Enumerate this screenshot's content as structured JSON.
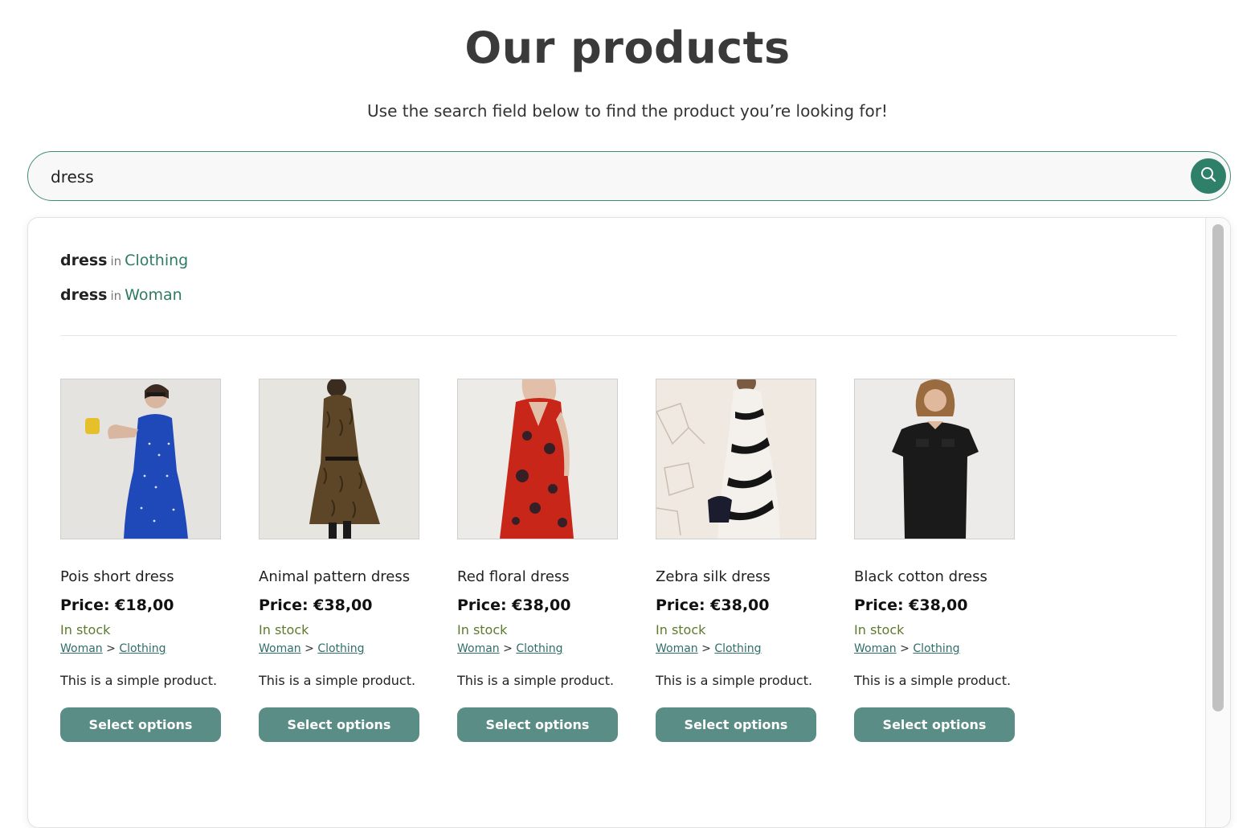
{
  "page": {
    "title": "Our products",
    "subtitle": "Use the search field below to find the product you’re looking for!"
  },
  "search": {
    "value": "dress",
    "icon": "search-icon",
    "accent_color": "#2f8068"
  },
  "suggestions": [
    {
      "term": "dress",
      "in_label": "in",
      "category": "Clothing"
    },
    {
      "term": "dress",
      "in_label": "in",
      "category": "Woman"
    }
  ],
  "products": [
    {
      "name": "Pois short dress",
      "price": "Price: €18,00",
      "stock": "In stock",
      "cat_parent": "Woman",
      "sep": ">",
      "cat_child": "Clothing",
      "description": "This is a simple product.",
      "button": "Select options",
      "image": "blue-polka-dot-dress-photo"
    },
    {
      "name": "Animal pattern dress",
      "price": "Price: €38,00",
      "stock": "In stock",
      "cat_parent": "Woman",
      "sep": ">",
      "cat_child": "Clothing",
      "description": "This is a simple product.",
      "button": "Select options",
      "image": "animal-pattern-dress-photo"
    },
    {
      "name": "Red floral dress",
      "price": "Price: €38,00",
      "stock": "In stock",
      "cat_parent": "Woman",
      "sep": ">",
      "cat_child": "Clothing",
      "description": "This is a simple product.",
      "button": "Select options",
      "image": "red-floral-dress-photo"
    },
    {
      "name": "Zebra silk dress",
      "price": "Price: €38,00",
      "stock": "In stock",
      "cat_parent": "Woman",
      "sep": ">",
      "cat_child": "Clothing",
      "description": "This is a simple product.",
      "button": "Select options",
      "image": "zebra-silk-dress-photo"
    },
    {
      "name": "Black cotton dress",
      "price": "Price: €38,00",
      "stock": "In stock",
      "cat_parent": "Woman",
      "sep": ">",
      "cat_child": "Clothing",
      "description": "This is a simple product.",
      "button": "Select options",
      "image": "black-cotton-dress-photo"
    }
  ],
  "colors": {
    "button_bg": "#5a8d86",
    "stock_text": "#5d7a2e",
    "link_text": "#2f6f6a"
  }
}
